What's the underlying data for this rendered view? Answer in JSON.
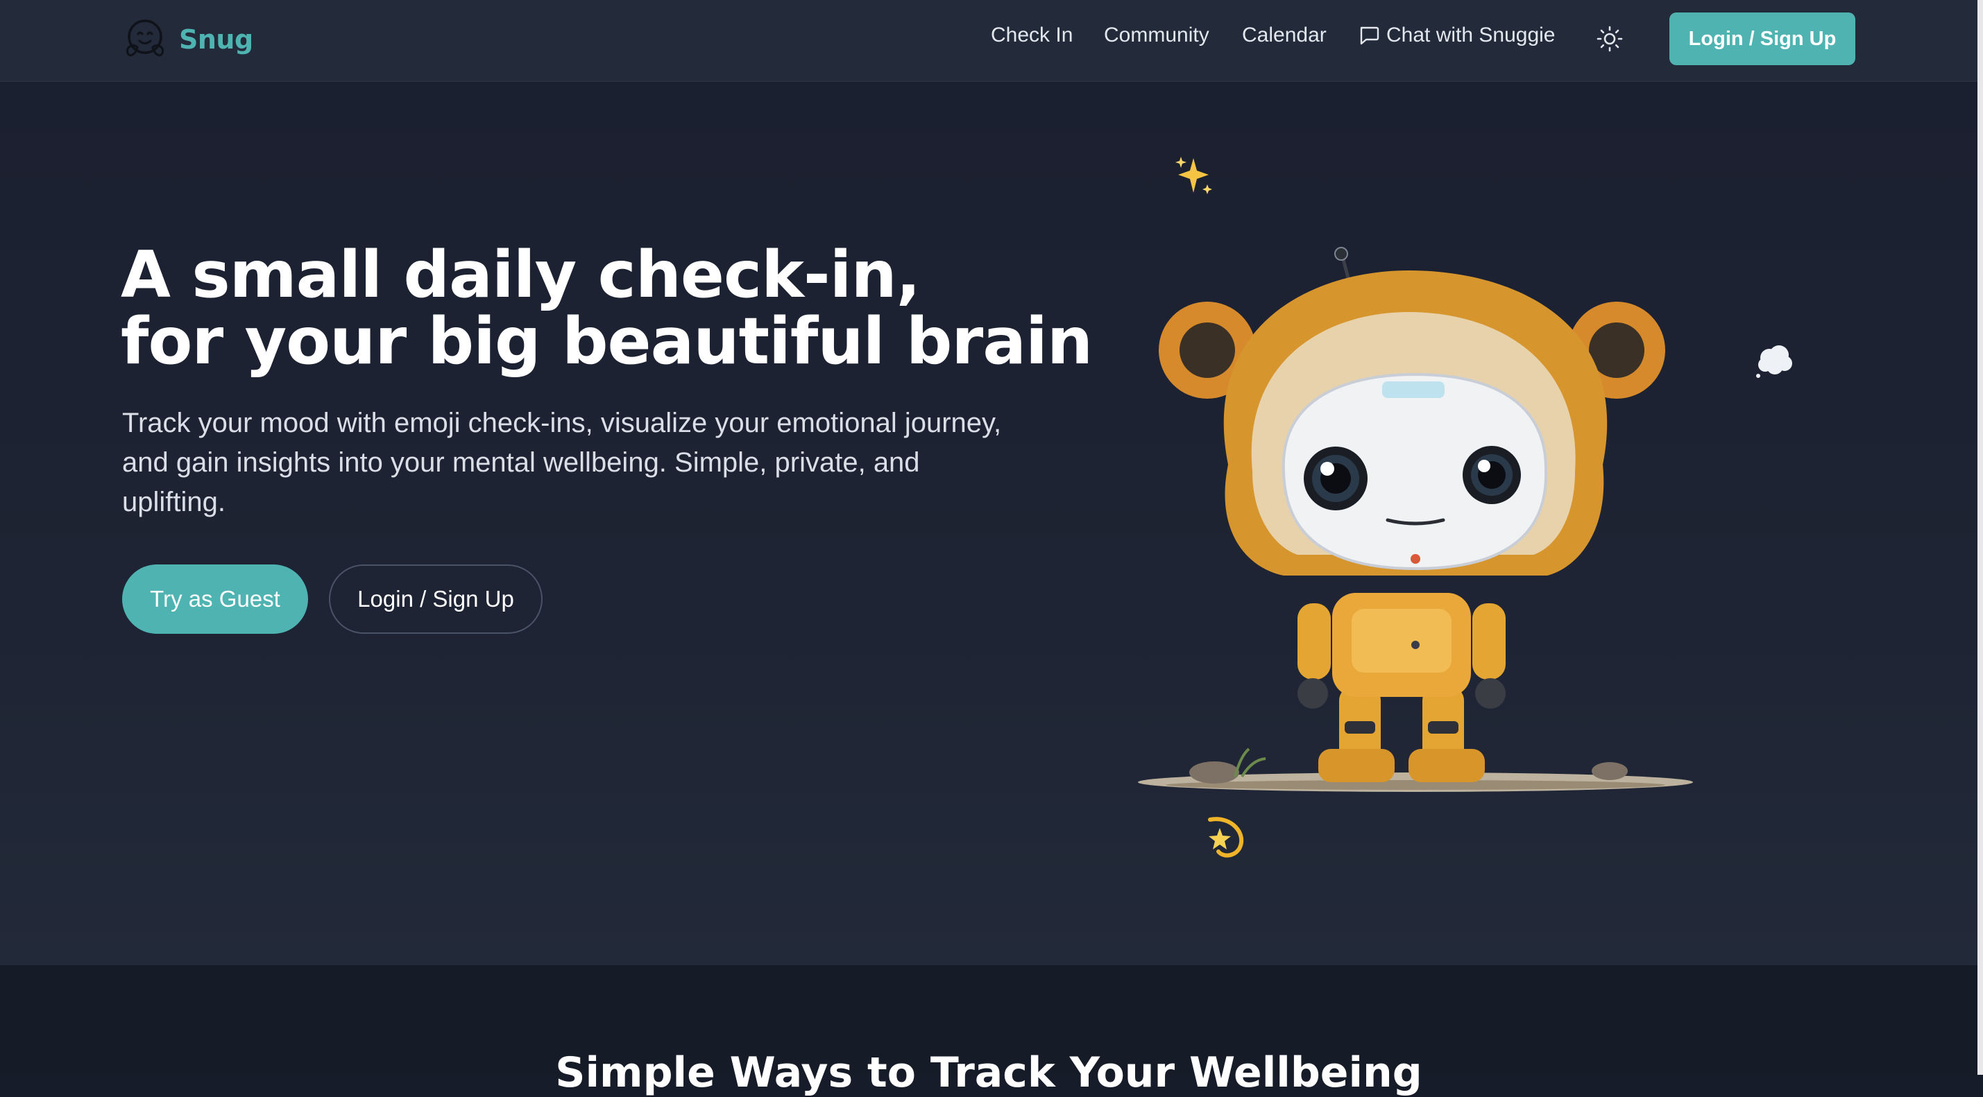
{
  "nav": {
    "brand": "Snug",
    "links": {
      "check_in": "Check In",
      "community": "Community",
      "calendar": "Calendar",
      "chat": "Chat with Snuggie"
    },
    "login_label": "Login / Sign Up"
  },
  "hero": {
    "title_line1": "A small daily check-in,",
    "title_line2": "for your big beautiful brain",
    "subtitle": "Track your mood with emoji check-ins, visualize your emotional journey, and gain insights into your mental wellbeing. Simple, private, and uplifting.",
    "guest_button": "Try as Guest",
    "login_button": "Login / Sign Up"
  },
  "next_section": {
    "title": "Simple Ways to Track Your Wellbeing"
  },
  "colors": {
    "accent": "#4fb3b2",
    "nav_bg": "#232a39",
    "page_bg": "#1b2030"
  },
  "icons": {
    "logo": "hugging-face-icon",
    "chat": "chat-bubble-icon",
    "theme": "sun-icon",
    "decor": [
      "sparkles-icon",
      "cloud-icon",
      "dizzy-star-icon"
    ]
  }
}
